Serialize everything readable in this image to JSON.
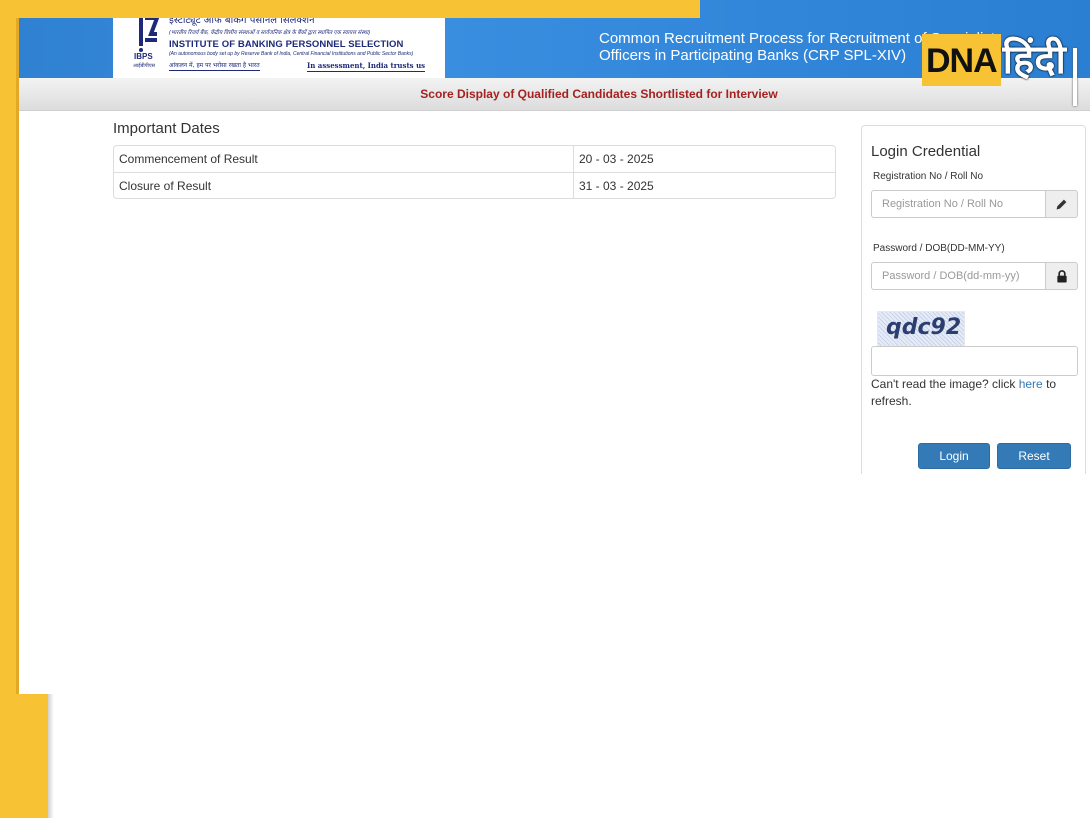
{
  "header": {
    "logo": {
      "hindi_name": "इंस्टीट्यूट ऑफ बैंकिंग पर्सोनल सिलेक्शन",
      "hindi_sub": "(भारतीय रिजर्व बैंक, केंद्रीय वित्तीय संस्थाओं व सार्वजनिक क्षेत्र के बैंकों द्वारा स्थापित एक स्वायत्त संस्था)",
      "english_name": "INSTITUTE OF BANKING PERSONNEL SELECTION",
      "english_sub": "(An autonomous body set up by Reserve Bank of India, Central Financial Institutions and Public Sector Banks)",
      "tagline_hindi": "आंकलन में, हम पर भरोसा रखता है भारत",
      "tagline_english": "In assessment, India trusts us",
      "mark_label": "IBPS",
      "mark_hindi": "आईबीपीएस"
    },
    "title_line1": "Common Recruitment Process for Recruitment of Specialist",
    "title_line2": "Officers in Participating Banks (CRP SPL-XIV)"
  },
  "watermark": {
    "en": "DNA",
    "hi": "हिंदी"
  },
  "subheader": {
    "text": "Score Display of Qualified Candidates Shortlisted for Interview"
  },
  "important_dates": {
    "title": "Important Dates",
    "rows": [
      {
        "label": "Commencement of Result",
        "value": "20 - 03 - 2025"
      },
      {
        "label": "Closure of Result",
        "value": "31 - 03 - 2025"
      }
    ]
  },
  "login": {
    "title": "Login Credential",
    "reg_label": "Registration No / Roll No",
    "reg_placeholder": "Registration No / Roll No",
    "reg_icon": "pencil-icon",
    "pwd_label": "Password / DOB(DD-MM-YY)",
    "pwd_placeholder": "Password / DOB(dd-mm-yy)",
    "pwd_icon": "lock-icon",
    "captcha_text": "qdc92",
    "refresh_prefix": "Can't read the image? click ",
    "refresh_link": "here",
    "refresh_suffix": " to refresh.",
    "login_button": "Login",
    "reset_button": "Reset"
  },
  "colors": {
    "header_blue": "#2f80d0",
    "subheader_red": "#a52121",
    "button_blue": "#337ab7",
    "frame_yellow": "#f7c234",
    "link_blue": "#337ab7"
  }
}
